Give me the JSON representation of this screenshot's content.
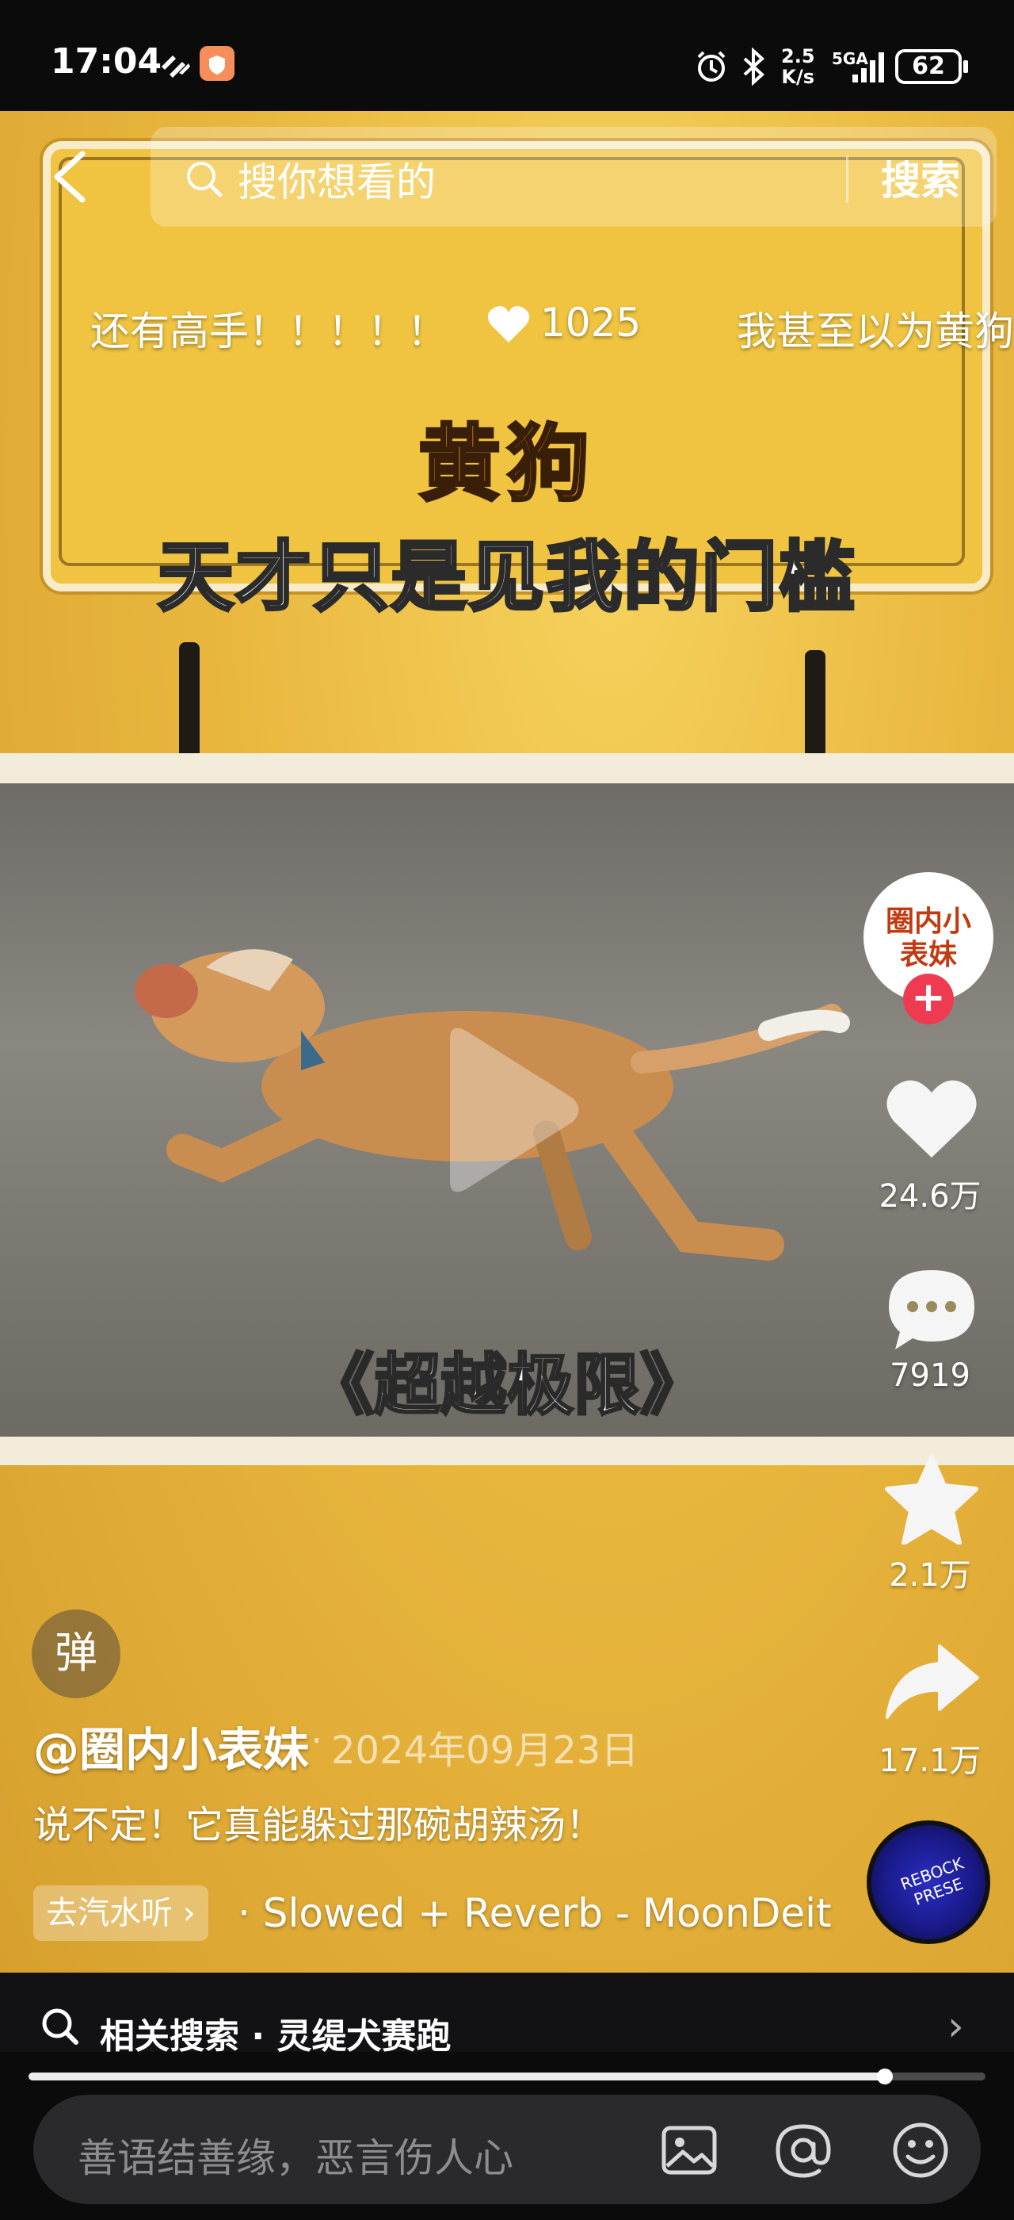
{
  "status_bar": {
    "time": "17:04",
    "net_speed_top": "2.5",
    "net_speed_unit": "K/s",
    "network": "5GA",
    "battery": "62"
  },
  "top_nav": {
    "search_placeholder": "搜你想看的",
    "search_button": "搜索"
  },
  "danmaku": [
    {
      "text": "还有高手！！！！！"
    },
    {
      "text": "1025"
    },
    {
      "text": "我甚至以为黄狗"
    }
  ],
  "video": {
    "sign_line1": "黄狗",
    "sign_line2": "天才只是见我的门槛",
    "caption": "《超越极限》"
  },
  "right_rail": {
    "avatar_text": "圈内小表妹",
    "follow_symbol": "+",
    "likes": "24.6万",
    "comments": "7919",
    "favorites": "2.1万",
    "shares": "17.1万",
    "disc_text": "REBOCK PRESE"
  },
  "post": {
    "danmu_toggle": "弹",
    "author": "@圈内小表妹",
    "date_separator": "·",
    "date": "2024年09月23日",
    "description": "说不定！它真能躲过那碗胡辣汤！",
    "music_tag": "去汽水听 ›",
    "music_title": "· Slowed + Reverb - MoonDeit"
  },
  "related_search": {
    "label": "相关搜索 · 灵缇犬赛跑",
    "chevron": "›"
  },
  "playback": {
    "progress": 0.895
  },
  "comment_bar": {
    "placeholder": "善语结善缘，恶言伤人心"
  },
  "colors": {
    "video_bg": "#e8b43b",
    "follow_red": "#ef3b52",
    "bar_bg": "#121214"
  }
}
